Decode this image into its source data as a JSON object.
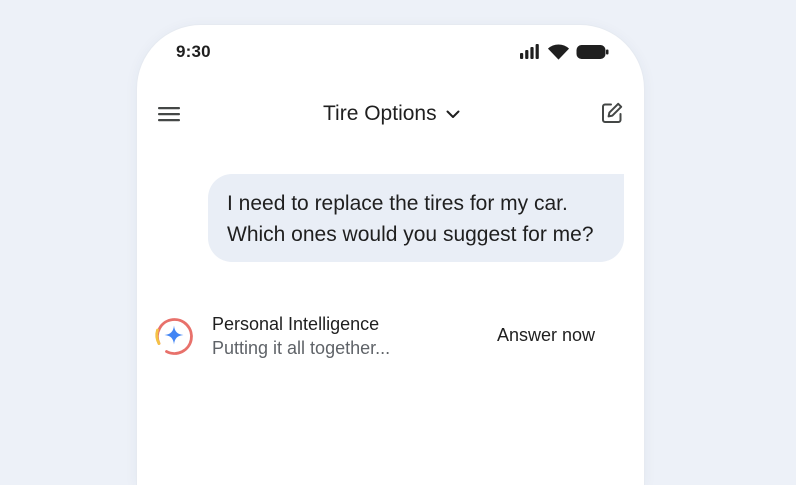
{
  "status_bar": {
    "time": "9:30",
    "icons": [
      "signal-icon",
      "wifi-icon",
      "battery-icon"
    ]
  },
  "header": {
    "title": "Tire Options",
    "icons": {
      "menu": "menu-icon",
      "dropdown": "chevron-down-icon",
      "new_chat": "edit-icon"
    }
  },
  "conversation": {
    "user_message": {
      "lines": [
        "I need to replace the tires for my car.",
        "Which ones would you suggest for me?"
      ]
    },
    "assistant": {
      "name": "Personal Intelligence",
      "status": "Putting it all together...",
      "action_label": "Answer now",
      "icon": "sparkle-icon"
    }
  },
  "colors": {
    "page_background": "#edf1f8",
    "phone_background": "#ffffff",
    "bubble_background": "#e9eef6",
    "text_primary": "#1f1f1f",
    "text_secondary": "#5f6368",
    "sparkle_blue": "#4285f4"
  }
}
